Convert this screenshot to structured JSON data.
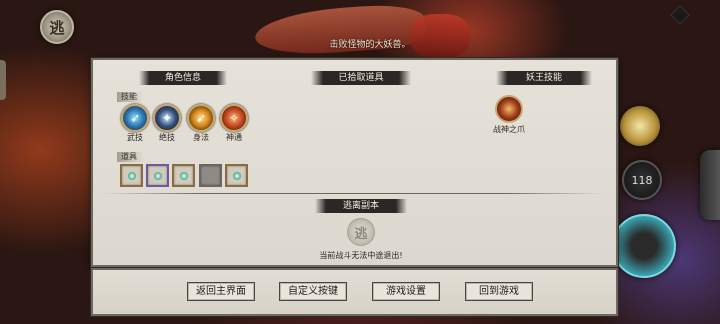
{
  "hud": {
    "top_emblem_glyph": "逃",
    "quest_text": "击败怪物的大妖兽。",
    "counter": "118"
  },
  "panel": {
    "role_info_title": "角色信息",
    "skills_tag": "技能",
    "skills": [
      {
        "label": "武技",
        "icon": "blade-skill-icon"
      },
      {
        "label": "绝技",
        "icon": "ultimate-skill-icon"
      },
      {
        "label": "身法",
        "icon": "movement-skill-icon"
      },
      {
        "label": "神通",
        "icon": "divine-skill-icon"
      }
    ],
    "items_tag": "道具",
    "item_slots": 5,
    "picked_items_title": "已拾取道具",
    "demon_king_title": "妖王技能",
    "demon_skill": {
      "label": "战神之爪",
      "icon": "war-god-claw-icon"
    },
    "escape_title": "逃离副本",
    "escape_icon_glyph": "逃",
    "escape_message": "当前战斗无法中途退出!"
  },
  "menu": {
    "main_menu": "返回主界面",
    "custom_keys": "自定义按键",
    "game_settings": "游戏设置",
    "back_to_game": "回到游戏"
  }
}
